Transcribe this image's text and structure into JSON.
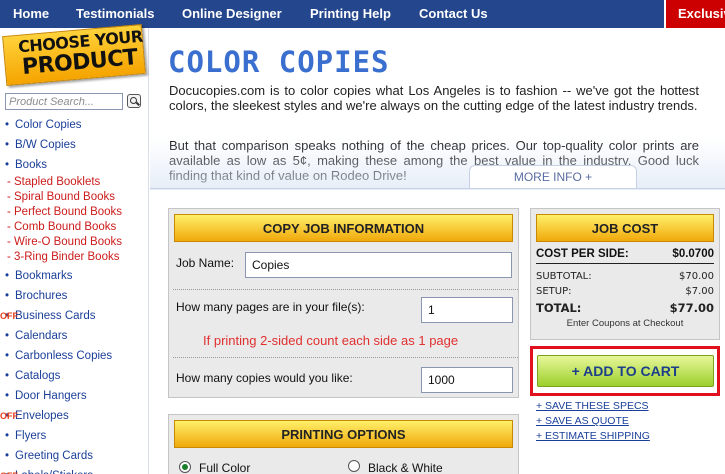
{
  "nav": {
    "items": [
      "Home",
      "Testimonials",
      "Online Designer",
      "Printing Help",
      "Contact Us"
    ],
    "exclusive": "Exclusiv"
  },
  "sidebar": {
    "badge_line1": "CHOOSE YOUR",
    "badge_line2": "PRODUCT",
    "search_placeholder": "Product Search...",
    "items": [
      {
        "label": "Color Copies",
        "type": "primary"
      },
      {
        "label": "B/W Copies",
        "type": "primary"
      },
      {
        "label": "Books",
        "type": "primary"
      },
      {
        "label": "Stapled Booklets",
        "type": "sub"
      },
      {
        "label": "Spiral Bound Books",
        "type": "sub"
      },
      {
        "label": "Perfect Bound Books",
        "type": "sub"
      },
      {
        "label": "Comb Bound Books",
        "type": "sub"
      },
      {
        "label": "Wire-O Bound Books",
        "type": "sub"
      },
      {
        "label": "3-Ring Binder Books",
        "type": "sub"
      },
      {
        "label": "Bookmarks",
        "type": "primary"
      },
      {
        "label": "Brochures",
        "type": "primary"
      },
      {
        "label": "Business Cards",
        "type": "primary",
        "badge": "OFF"
      },
      {
        "label": "Calendars",
        "type": "primary"
      },
      {
        "label": "Carbonless Copies",
        "type": "primary"
      },
      {
        "label": "Catalogs",
        "type": "primary"
      },
      {
        "label": "Door Hangers",
        "type": "primary"
      },
      {
        "label": "Envelopes",
        "type": "primary",
        "badge": "OFF"
      },
      {
        "label": "Flyers",
        "type": "primary"
      },
      {
        "label": "Greeting Cards",
        "type": "primary"
      },
      {
        "label": "Labels/Stickers",
        "type": "primary",
        "badge": "OFF"
      }
    ]
  },
  "main": {
    "title": "COLOR COPIES",
    "intro1": "Docucopies.com is to color copies what Los Angeles is to fashion -- we've got the hottest colors, the sleekest styles and we're always on the cutting edge of the latest industry trends.",
    "intro2": "But that comparison speaks nothing of the cheap prices. Our top-quality color prints are available as low as 5¢, making these among the best value in the industry. Good luck finding that kind of value on Rodeo Drive!",
    "more_info": "MORE INFO +"
  },
  "copy_job": {
    "heading": "COPY JOB INFORMATION",
    "job_name_label": "Job Name:",
    "job_name_value": "Copies",
    "pages_label": "How many pages are in your file(s):",
    "pages_value": "1",
    "two_sided_note": "If printing 2-sided count each side as 1 page",
    "copies_label": "How many copies would you like:",
    "copies_value": "1000"
  },
  "job_cost": {
    "heading": "JOB COST",
    "cost_per_side_label": "COST PER SIDE:",
    "cost_per_side_value": "$0.0700",
    "subtotal_label": "SUBTOTAL:",
    "subtotal_value": "$70.00",
    "setup_label": "SETUP:",
    "setup_value": "$7.00",
    "total_label": "TOTAL:",
    "total_value": "$77.00",
    "coupon_note": "Enter Coupons at Checkout",
    "add_to_cart": "+ ADD TO CART",
    "links": [
      "+ SAVE THESE SPECS",
      "+ SAVE AS QUOTE",
      "+ ESTIMATE SHIPPING"
    ]
  },
  "printing_options": {
    "heading": "PRINTING OPTIONS",
    "options": [
      {
        "label": "Full Color",
        "selected": true
      },
      {
        "label": "Black & White",
        "selected": false
      }
    ]
  },
  "colors": {
    "nav_bg": "#24468d",
    "accent_blue": "#3b6fcf",
    "link_blue": "#1a3f99",
    "sub_red": "#cc1b1b",
    "highlight_red": "#e0101c",
    "cart_green": "#9ccf2c"
  }
}
